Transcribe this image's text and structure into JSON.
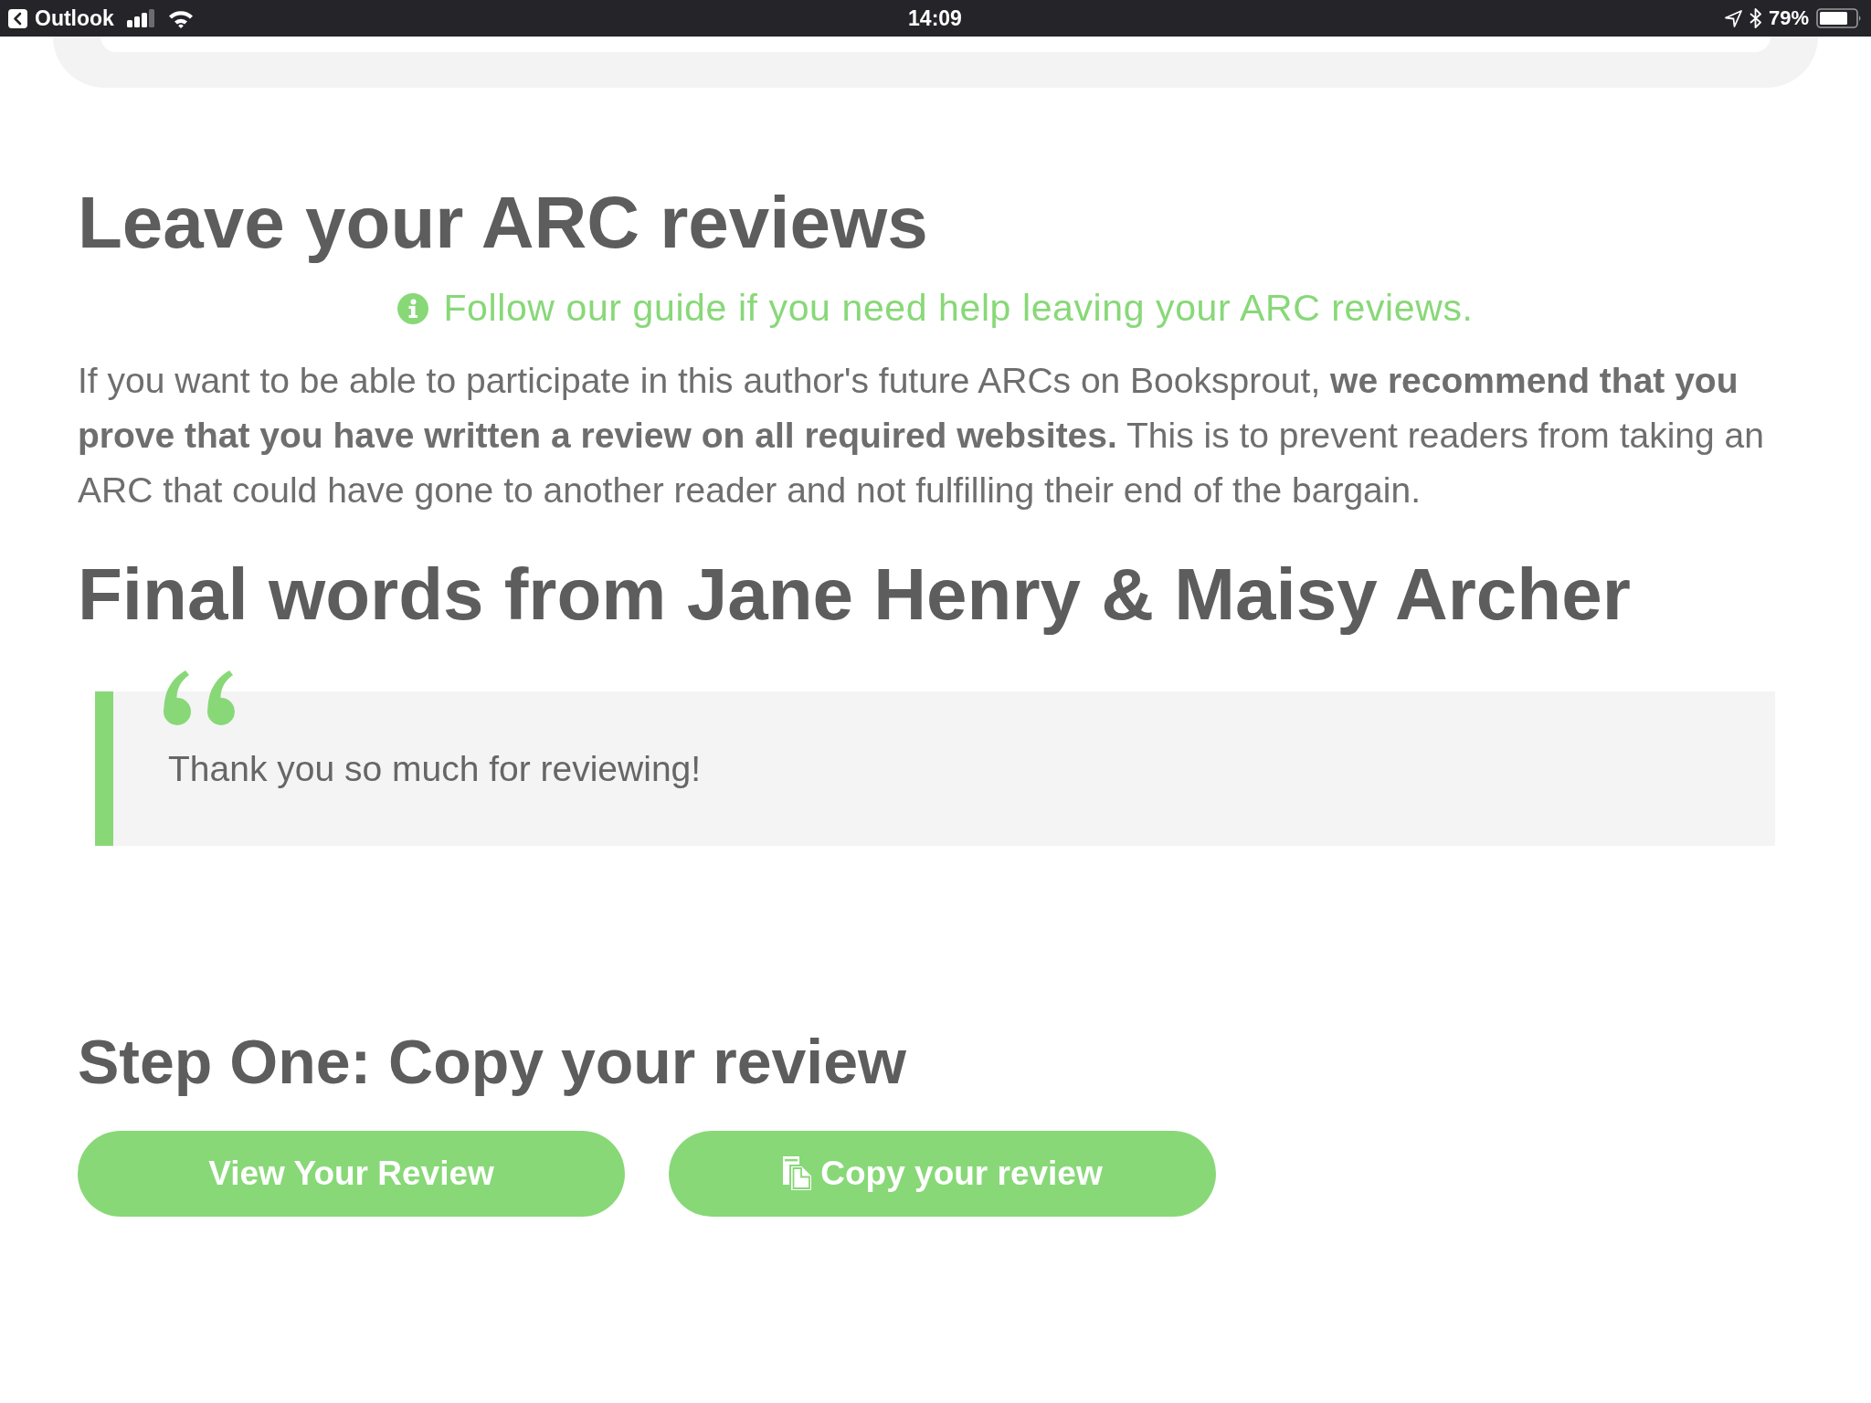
{
  "status_bar": {
    "back_app": "Outlook",
    "time": "14:09",
    "battery": "79%"
  },
  "review_section": {
    "title": "Leave your ARC reviews",
    "guide_link": "Follow our guide if you need help leaving your ARC reviews.",
    "body": "If you want to be able to participate in this author's future ARCs on Booksprout, **we recommend that you prove that you have written a review on all required websites.** This is to prevent readers from taking an ARC that could have gone to another reader and not fulfilling their end of the bargain."
  },
  "final_words": {
    "title": "Final words from Jane Henry & Maisy Archer",
    "quote": "Thank you so much for reviewing!"
  },
  "step_one": {
    "title": "Step One: Copy your review",
    "buttons": [
      {
        "label": "View Your Review",
        "kind": "view"
      },
      {
        "label": "Copy your review",
        "kind": "copy"
      }
    ]
  }
}
